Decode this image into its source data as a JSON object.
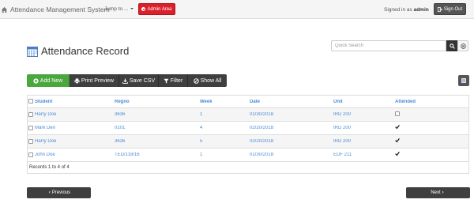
{
  "navbar": {
    "brand": "Attendance Management System",
    "jump_label": "Jump to ...",
    "admin_label": "Admin Area",
    "signed_prefix": "Signed in as",
    "signed_user": "admin",
    "signout_label": "Sign Out"
  },
  "search": {
    "placeholder": "Quick Search"
  },
  "page": {
    "title": "Attendance Record"
  },
  "toolbar": {
    "add_new": "Add New",
    "print_preview": "Print Preview",
    "save_csv": "Save CSV",
    "filter": "Filter",
    "show_all": "Show All"
  },
  "table": {
    "columns": [
      "Student",
      "Regno",
      "Week",
      "Date",
      "Unit",
      "Attended"
    ],
    "rows": [
      {
        "student": "Harry Doe",
        "regno": "3636",
        "week": "1",
        "date": "01/30/2018",
        "unit": "IRD 200",
        "attended": false
      },
      {
        "student": "Mark Den",
        "regno": "0101",
        "week": "4",
        "date": "02/20/2018",
        "unit": "IRD 200",
        "attended": true
      },
      {
        "student": "Harry Doe",
        "regno": "3636",
        "week": "5",
        "date": "02/20/2018",
        "unit": "IRD 200",
        "attended": true
      },
      {
        "student": "John Doe",
        "regno": "TED/118/16",
        "week": "1",
        "date": "01/30/2018",
        "unit": "EDF 211",
        "attended": true
      }
    ],
    "footer": "Records 1 to 4 of 4"
  },
  "pager": {
    "previous": "Previous",
    "next": "Next"
  },
  "colors": {
    "accent_link": "#4a8bd6",
    "admin_red": "#d9202b",
    "add_green": "#4aa73d",
    "dark_btn": "#3f3f3f"
  }
}
